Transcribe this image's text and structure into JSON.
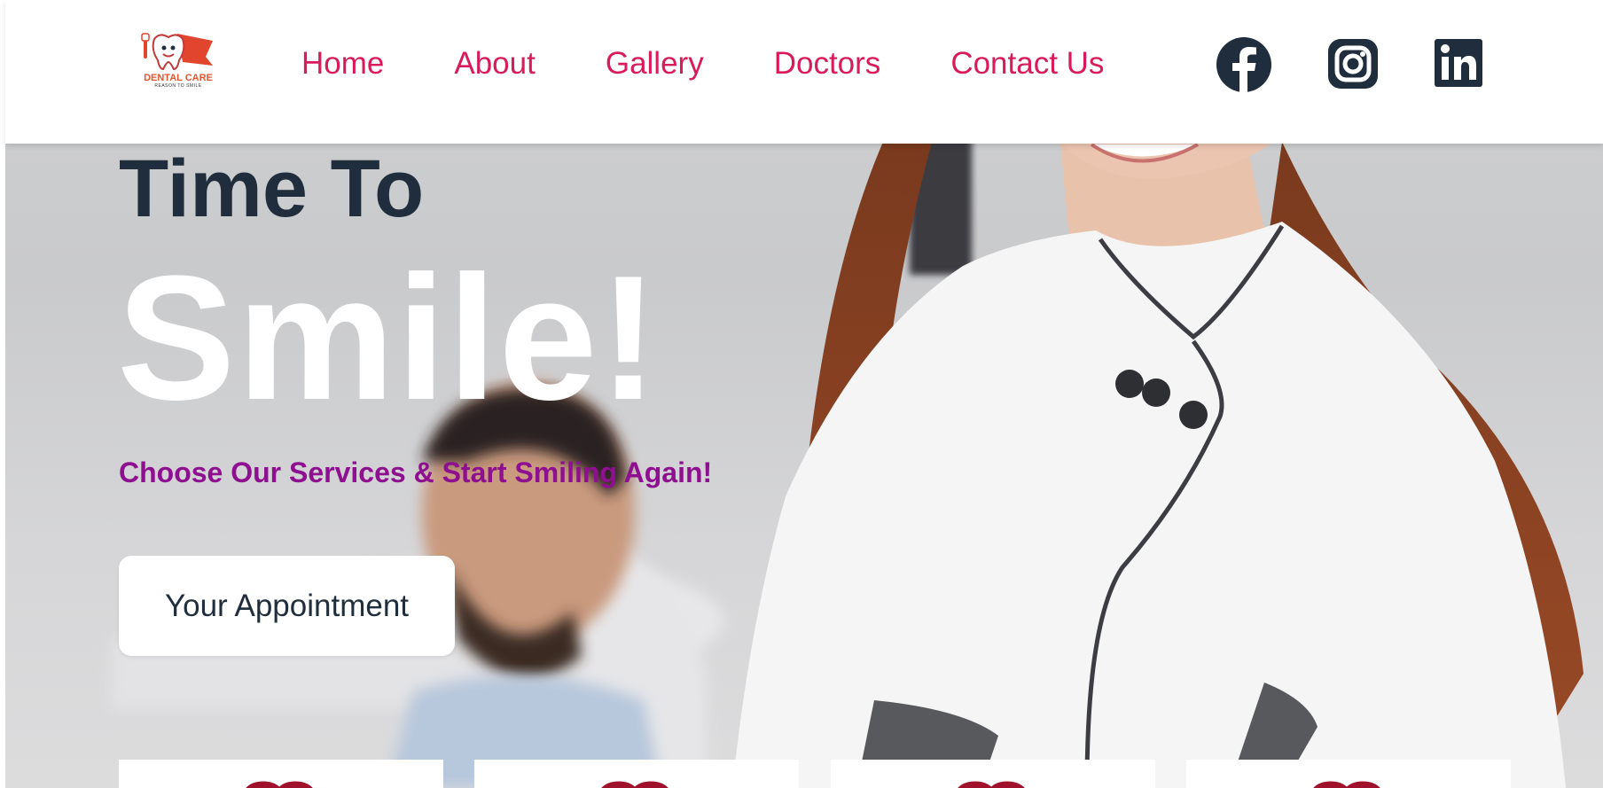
{
  "header": {
    "logo": {
      "brand": "DENTAL CARE",
      "tagline": "REASON TO SMILE",
      "icon": "tooth-mascot-logo"
    },
    "nav": [
      {
        "label": "Home"
      },
      {
        "label": "About"
      },
      {
        "label": "Gallery"
      },
      {
        "label": "Doctors"
      },
      {
        "label": "Contact Us"
      }
    ],
    "social": [
      {
        "icon": "facebook-icon"
      },
      {
        "icon": "instagram-icon"
      },
      {
        "icon": "linkedin-icon"
      }
    ]
  },
  "hero": {
    "line1": "Time To",
    "line2": "Smile!",
    "subtitle": "Choose Our Services & Start Smiling Again!",
    "cta_label": "Your Appointment",
    "background": "dentist-and-patient-photo"
  },
  "service_cards": [
    {
      "icon": "service-icon"
    },
    {
      "icon": "service-icon"
    },
    {
      "icon": "service-icon"
    },
    {
      "icon": "service-icon"
    }
  ],
  "colors": {
    "nav_text": "#d81b5c",
    "heading_dark": "#1f2d3d",
    "subtitle": "#8e0f8f",
    "social_icon": "#1f2d3d",
    "card_icon": "#a0112b"
  }
}
